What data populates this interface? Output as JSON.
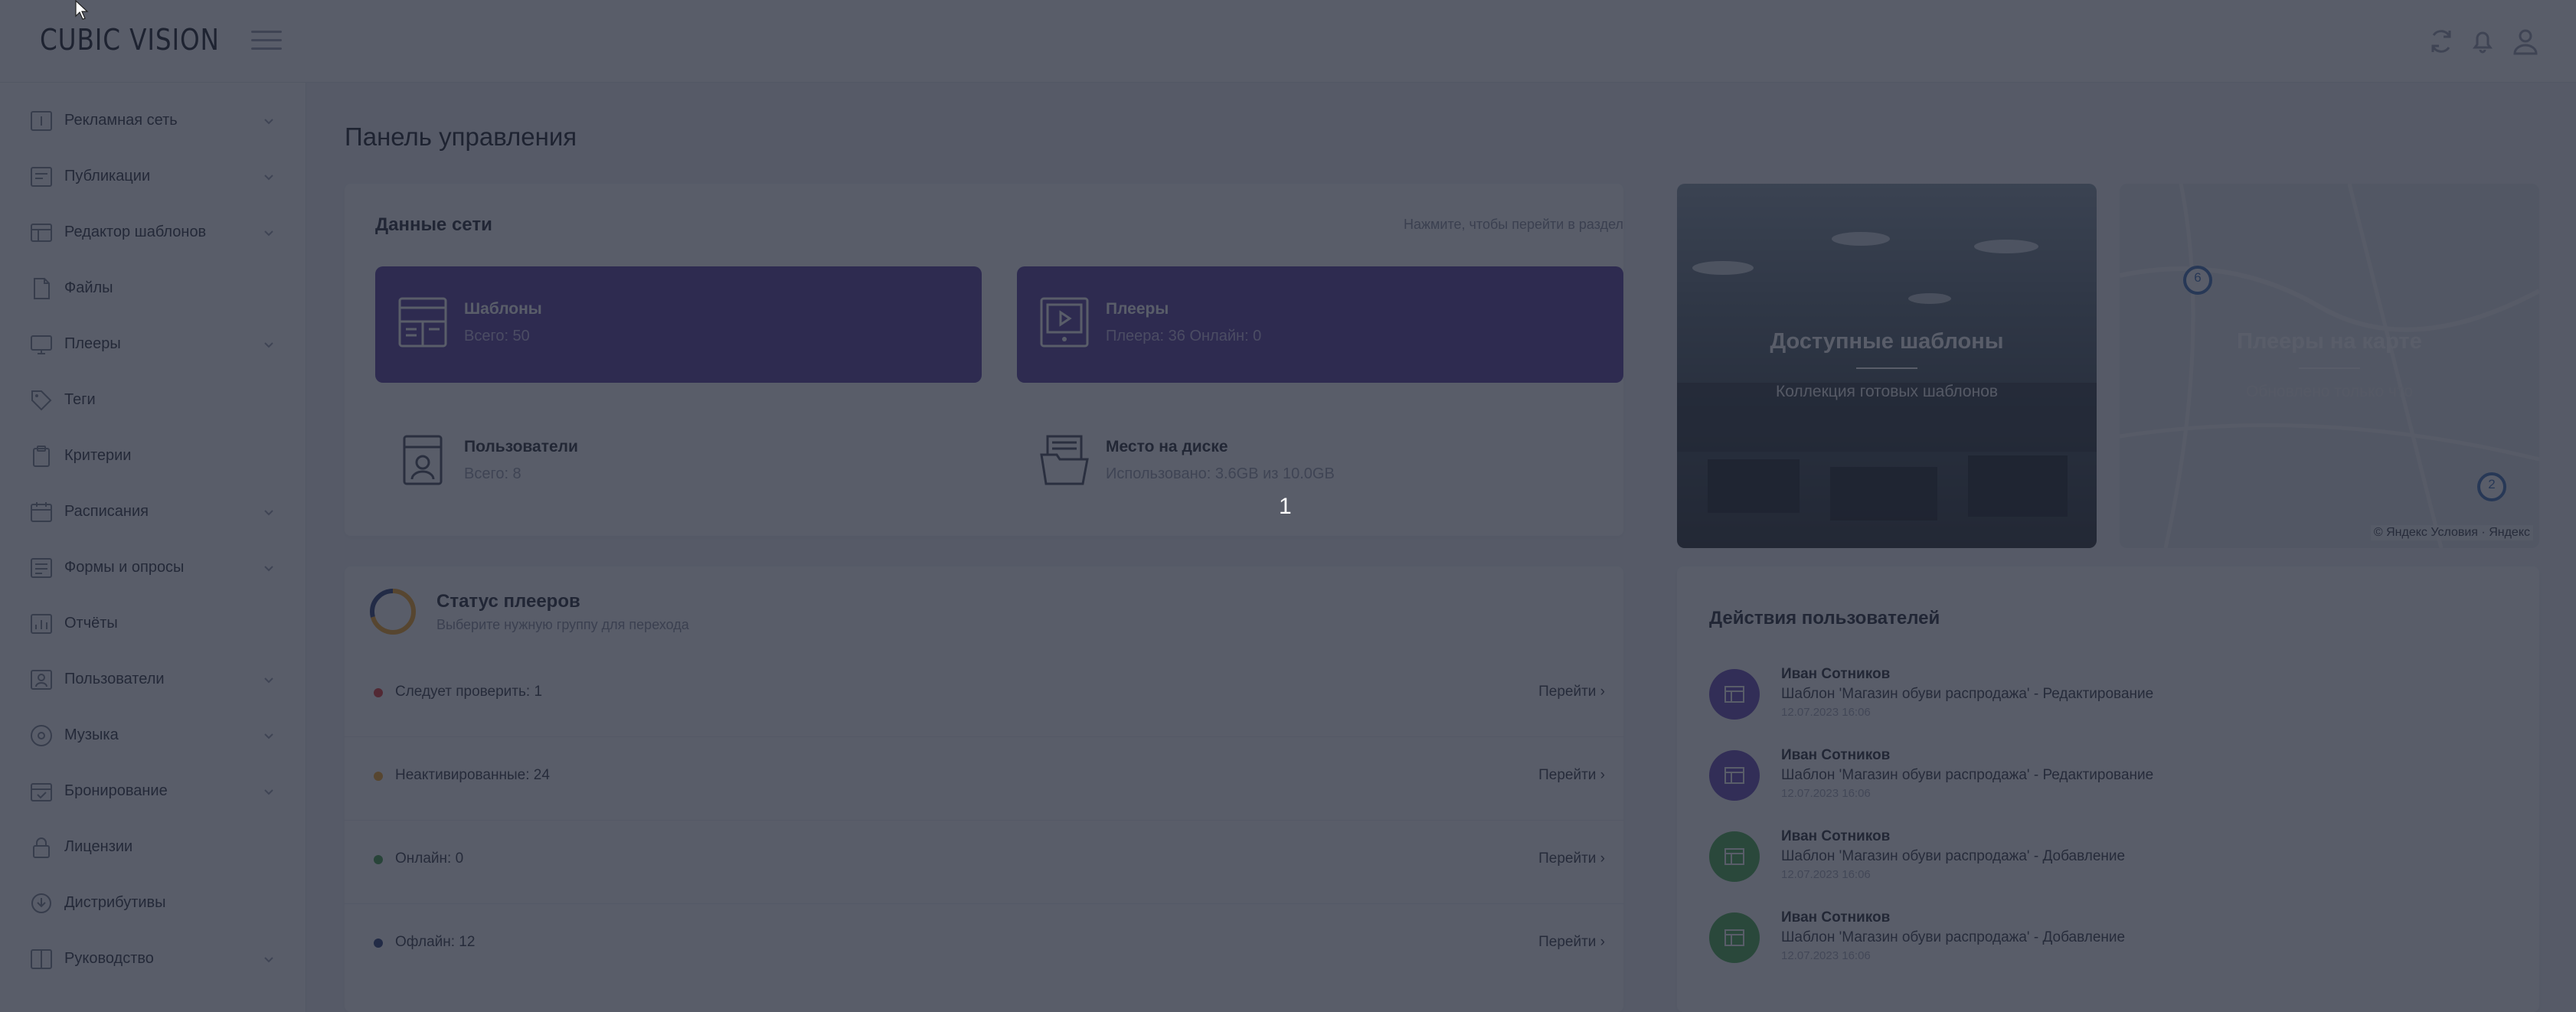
{
  "header": {
    "logo": "CUBIC VISION",
    "icons": [
      "refresh-icon",
      "bell-icon",
      "user-icon"
    ]
  },
  "sidebar": {
    "items": [
      {
        "label": "Рекламная сеть",
        "icon": "network-icon",
        "has_children": true
      },
      {
        "label": "Публикации",
        "icon": "publications-icon",
        "has_children": true
      },
      {
        "label": "Редактор шаблонов",
        "icon": "template-editor-icon",
        "has_children": true
      },
      {
        "label": "Файлы",
        "icon": "files-icon",
        "has_children": false
      },
      {
        "label": "Плееры",
        "icon": "players-icon",
        "has_children": true
      },
      {
        "label": "Теги",
        "icon": "tags-icon",
        "has_children": false
      },
      {
        "label": "Критерии",
        "icon": "criteria-icon",
        "has_children": false
      },
      {
        "label": "Расписания",
        "icon": "schedule-icon",
        "has_children": true
      },
      {
        "label": "Формы и опросы",
        "icon": "forms-icon",
        "has_children": true
      },
      {
        "label": "Отчёты",
        "icon": "reports-icon",
        "has_children": false
      },
      {
        "label": "Пользователи",
        "icon": "users-icon",
        "has_children": true
      },
      {
        "label": "Музыка",
        "icon": "music-icon",
        "has_children": true
      },
      {
        "label": "Бронирование",
        "icon": "booking-icon",
        "has_children": true
      },
      {
        "label": "Лицензии",
        "icon": "licenses-icon",
        "has_children": false
      },
      {
        "label": "Дистрибутивы",
        "icon": "distributions-icon",
        "has_children": false
      },
      {
        "label": "Руководство",
        "icon": "guide-icon",
        "has_children": true
      }
    ]
  },
  "main": {
    "page_title": "Панель управления",
    "network": {
      "title": "Данные сети",
      "hint": "Нажмите, чтобы перейти в раздел",
      "tiles": [
        {
          "title": "Шаблоны",
          "subtitle": "Всего: 50",
          "icon": "templates-icon"
        },
        {
          "title": "Плееры",
          "subtitle": "Плеера: 36 Онлайн: 0",
          "icon": "player-screen-icon"
        },
        {
          "title": "Пользователи",
          "subtitle": "Всего: 8",
          "icon": "user-card-icon"
        },
        {
          "title": "Место на диске",
          "subtitle": "Использовано: 3.6GB из 10.0GB",
          "icon": "folder-icon"
        }
      ]
    },
    "promos": [
      {
        "title": "Доступные шаблоны",
        "subtitle": "Коллекция готовых шаблонов"
      },
      {
        "title": "Плееры на карте",
        "subtitle": "Обновлено только что",
        "markers": [
          "6",
          "2"
        ],
        "attribution": "© Яндекс Условия · Яндекс"
      }
    ],
    "player_status": {
      "title": "Статус плееров",
      "subtitle": "Выберите нужную группу для перехода",
      "link_label": "Перейти",
      "rows": [
        {
          "label": "Следует проверить: 1",
          "color": "#e53935"
        },
        {
          "label": "Неактивированные: 24",
          "color": "#f5a623"
        },
        {
          "label": "Онлайн: 0",
          "color": "#43a047"
        },
        {
          "label": "Офлайн: 12",
          "color": "#2c3e78"
        }
      ]
    },
    "user_actions": {
      "title": "Действия пользователей",
      "items": [
        {
          "name": "Иван Сотников",
          "action": "Шаблон 'Магазин обуви распродажа' - Редактирование",
          "time": "12.07.2023 16:06",
          "color": "#6a4bb8"
        },
        {
          "name": "Иван Сотников",
          "action": "Шаблон 'Магазин обуви распродажа' - Редактирование",
          "time": "12.07.2023 16:06",
          "color": "#6a4bb8"
        },
        {
          "name": "Иван Сотников",
          "action": "Шаблон 'Магазин обуви распродажа' - Добавление",
          "time": "12.07.2023 16:06",
          "color": "#4caf50"
        },
        {
          "name": "Иван Сотников",
          "action": "Шаблон 'Магазин обуви распродажа' - Добавление",
          "time": "12.07.2023 16:06",
          "color": "#4caf50"
        }
      ]
    }
  },
  "tour": {
    "step": "1"
  },
  "colors": {
    "accent": "#5a3fa0",
    "overlay": "rgba(31,36,52,0.74)"
  }
}
